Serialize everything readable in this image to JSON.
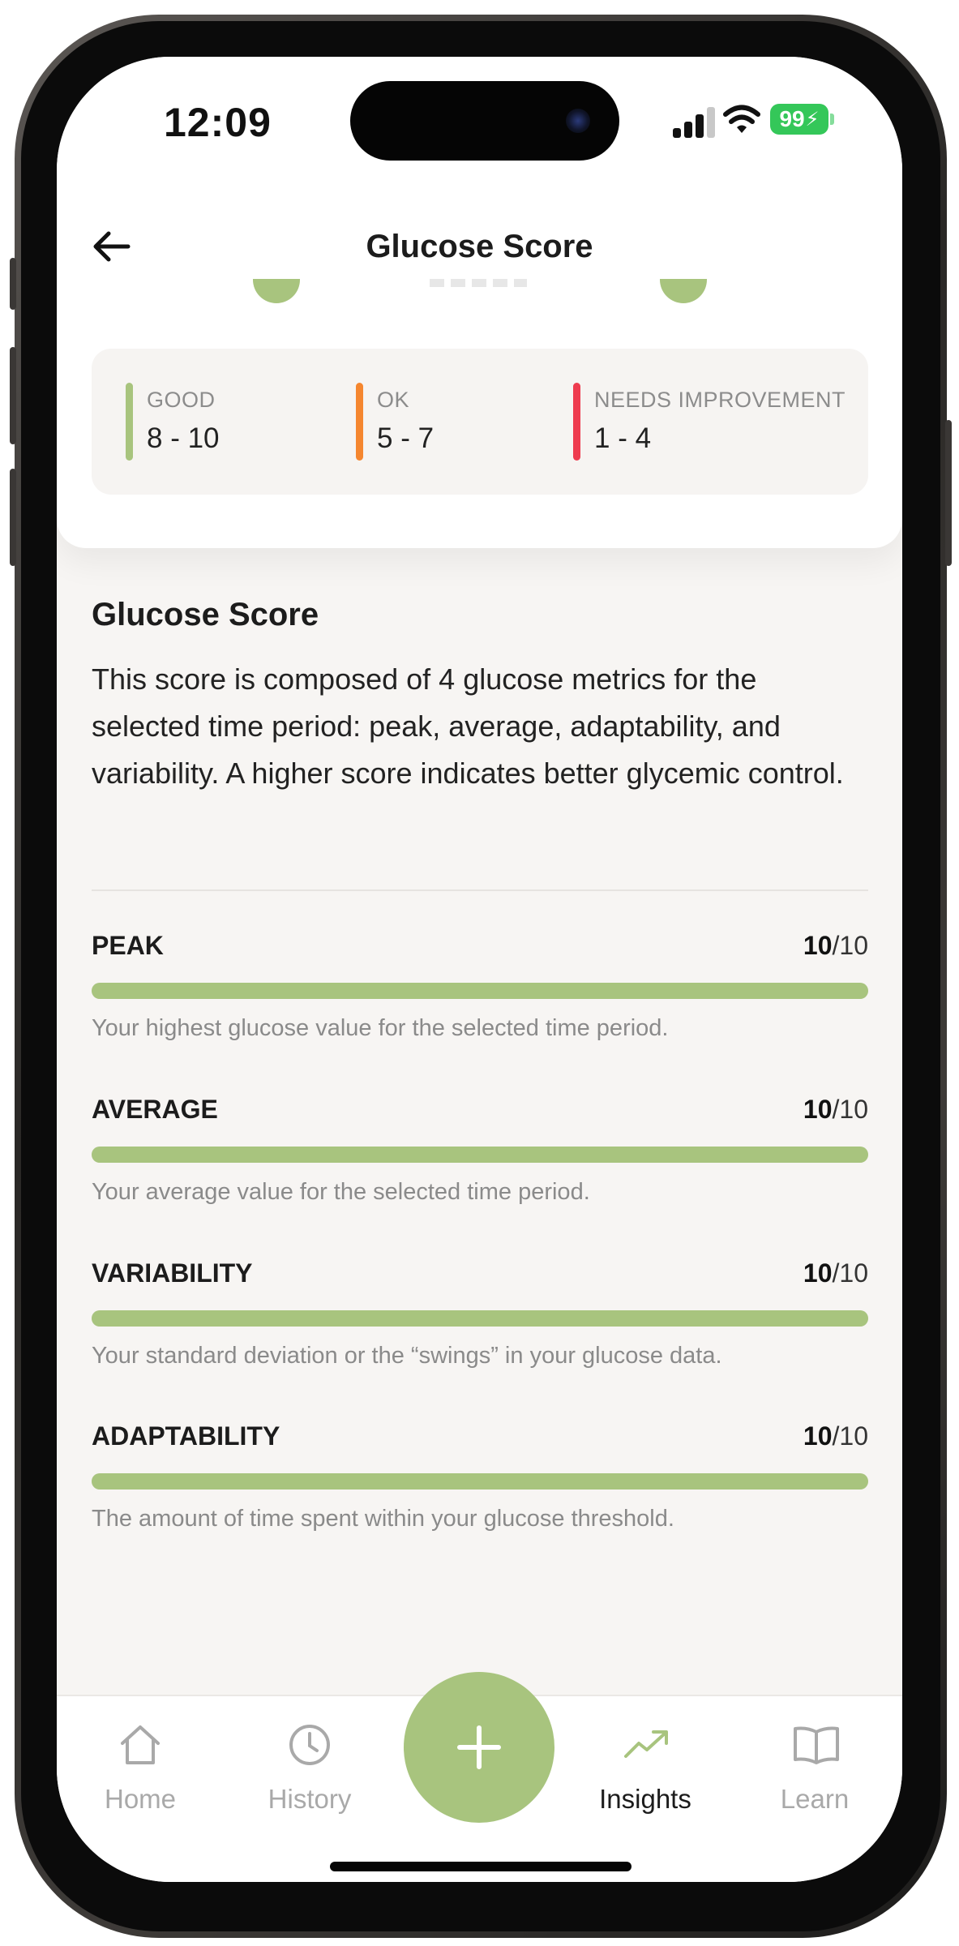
{
  "status_bar": {
    "time": "12:09",
    "battery": "99"
  },
  "header": {
    "title": "Glucose Score"
  },
  "legend": [
    {
      "label": "GOOD",
      "range": "8 - 10",
      "color": "#a8c47e"
    },
    {
      "label": "OK",
      "range": "5 - 7",
      "color": "#f5862f"
    },
    {
      "label": "NEEDS IMPROVEMENT",
      "range": "1 - 4",
      "color": "#ee3b4f"
    }
  ],
  "section": {
    "title": "Glucose Score",
    "description": "This score is composed of 4 glucose metrics for the selected time period: peak, average, adaptability, and variability. A higher score indicates better glycemic control."
  },
  "metrics": [
    {
      "name": "PEAK",
      "score": "10",
      "max": "/10",
      "level": 1.0,
      "description": "Your highest glucose value for the selected time period."
    },
    {
      "name": "AVERAGE",
      "score": "10",
      "max": "/10",
      "level": 1.0,
      "description": "Your average value for the selected time period."
    },
    {
      "name": "VARIABILITY",
      "score": "10",
      "max": "/10",
      "level": 1.0,
      "description": "Your standard deviation or the “swings” in your glucose data."
    },
    {
      "name": "ADAPTABILITY",
      "score": "10",
      "max": "/10",
      "level": 1.0,
      "description": "The amount of time spent within your glucose threshold."
    }
  ],
  "tabbar": {
    "home": "Home",
    "history": "History",
    "insights": "Insights",
    "learn": "Learn"
  },
  "colors": {
    "accent": "#a8c47e",
    "text": "#1c1c1c",
    "muted": "#8a8a8a"
  }
}
